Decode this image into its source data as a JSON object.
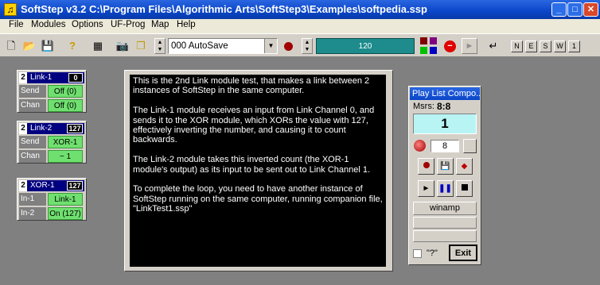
{
  "window": {
    "title": "SoftStep v3.2 C:\\Program Files\\Algorithmic Arts\\SoftStep3\\Examples\\softpedia.ssp",
    "minimize": "_",
    "maximize": "□",
    "close": "✕"
  },
  "menu": [
    "File",
    "Modules",
    "Options",
    "UF-Prog",
    "Map",
    "Help"
  ],
  "toolbar": {
    "preset": "000 AutoSave",
    "tempo": "120",
    "channel_buttons": [
      "N",
      "E",
      "S",
      "W",
      "1"
    ]
  },
  "modules": [
    {
      "num": "2",
      "name": "Link-1",
      "value": "0",
      "rows": [
        {
          "label": "Send",
          "value": "Off (0)"
        },
        {
          "label": "Chan",
          "value": "Off (0)"
        }
      ]
    },
    {
      "num": "2",
      "name": "Link-2",
      "value": "127",
      "rows": [
        {
          "label": "Send",
          "value": "XOR-1"
        },
        {
          "label": "Chan",
          "value": "~  1"
        }
      ]
    },
    {
      "num": "2",
      "name": "XOR-1",
      "value": "127",
      "rows": [
        {
          "label": "In-1",
          "value": "Link-1"
        },
        {
          "label": "In-2",
          "value": "On (127)"
        }
      ]
    }
  ],
  "notes": {
    "p1": "This is the 2nd Link module test, that makes a link between 2 instances of SoftStep in the same computer.",
    "p2": "The Link-1 module receives an input from Link Channel 0, and sends it to the XOR module, which XORs the value with 127, effectively inverting the number, and causing it to count backwards.",
    "p3": "The Link-2 module takes this inverted count (the XOR-1 module's output) as its input  to be sent out to Link Channel 1.",
    "p4": "To complete the loop, you need to have another  instance of SoftStep running on the same computer, running companion file, \"LinkTest1.ssp\""
  },
  "playlist": {
    "title": "Play List Compo...",
    "msrs_label": "Msrs:",
    "msrs_value": "8:8",
    "big_value": "1",
    "count": "8",
    "winamp": "winamp",
    "checkbox_label": "\"?\"",
    "exit": "Exit"
  },
  "colors": {
    "title_blue": "#0a46c8",
    "module_green": "#6fe06f",
    "tempo_teal": "#1e8c8c",
    "display_cyan": "#b8f4f4"
  }
}
